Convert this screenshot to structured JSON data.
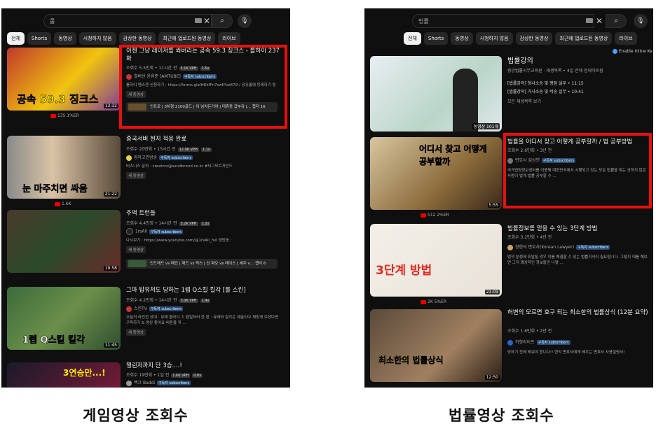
{
  "left": {
    "search_text": "롤",
    "chips": [
      "전체",
      "Shorts",
      "동영상",
      "시청하지 않음",
      "감상한 동영상",
      "최근에 업로드된 동영상",
      "라이브"
    ],
    "videos": [
      {
        "title": "이젠 그냥 레이저를 쏴버리는 공속 59.3 징크스 - 롤하이 237화",
        "meta": "조회수 5.5만회 • 11시간 전",
        "badges": [
          "5.1K VPH",
          "1.5x"
        ],
        "channel": "열버선 윤휴준 [AMTUBE]",
        "sub": "구독자 subscribers",
        "desc": "롤하이 멤스젠 신청하기 : https://forms.gle/ftEkfFn7sz4Pve679 / 공유롭에 등록하기 링크...",
        "newtag": "새 동영상",
        "chapter": "인트로 | 3차형 2100골드 | 이 넘치든거야 | 대휴동 갑부유 |… 챕터 16",
        "duration": "13:32",
        "stat": "135 1%ER",
        "thumb_text": "공속 59.3 징크스"
      },
      {
        "title": "중국서버 현지 적응 완료",
        "meta": "조회수 20만회 • 15시간 전",
        "badges": [
          "12.9K VPH",
          "1.1x"
        ],
        "channel": "동아고민방송",
        "sub": "구독자 subscribers",
        "desc": "비즈니스 문의 : creators@sandbrand.co.kr #티그모트개인드",
        "newtag": "새 동영상",
        "chapter": "",
        "duration": "21:22",
        "stat": "1.6K",
        "thumb_text": "눈 마주치면 싸움"
      },
      {
        "title": "주먹 트런들",
        "meta": "조회수 4.4만회 • 14시간 전",
        "badges": [
          "3.2K VPH",
          "1.2x"
        ],
        "channel": "1rsAll",
        "sub": "구독자 subscribers",
        "desc": "다시보기 : https://www.youtube.com/@1rsAll_full 생방송 : https://chzzk.naver.com/c74...",
        "newtag": "새 동영상",
        "chapter": "인드레드 vs 페인 | 제드 vs 럭스 | 신 짜오 vs 레이스 | 세주 v… 챕터 6",
        "duration": "19:58",
        "stat": "",
        "thumb_text": ""
      },
      {
        "title": "그마 탑유저도 당하는 1렙 Q스킬 킬각 [롤 스킨]",
        "meta": "조회수 4.2만회 • 14시간 전",
        "badges": [
          "3.0K VPH",
          "1.4x"
        ],
        "channel": "스킨TV",
        "sub": "구독자 subscribers",
        "desc": "오늘의 라인전 상대 : 뮤레 블라디 ㅎ 팬킬처러 한 판 : 뮤레와 칼각은 예술이다 재밌게 보셨다면 구독하기 & 영상 좋아요 버튼을 꼭 ...",
        "newtag": "새 동영상",
        "chapter": "",
        "duration": "11:45",
        "stat": "",
        "thumb_text": "1렙 Q스킬 킬각"
      },
      {
        "title": "챌린저까지 단 3승....!",
        "meta": "조회수 19만회 • 1일 전",
        "badges": [
          "1.6K VPH",
          "0.8x"
        ],
        "channel": "백크 Baddi",
        "sub": "구독자 subscribers",
        "desc": "",
        "newtag": "",
        "chapter": "",
        "duration": "",
        "stat": "",
        "thumb_text": "3연승만...!"
      }
    ],
    "caption": "게임영상 조회수"
  },
  "right": {
    "search_text": "법률",
    "chips": [
      "전체",
      "Shorts",
      "동영상",
      "시청하지 않음",
      "감상한 동영상",
      "최근에 업로드된 동영상",
      "라이브"
    ],
    "inline_toggle": "Enable Inline Ke",
    "videos": [
      {
        "title": "법률강의",
        "meta": "중앙법률사무교육원 · 재생목록 • 4일 전에 업데이트됨",
        "lines": [
          "[법률강의] 형사소송 및 쟁점 실무 • 11:15",
          "[법률강의] 가사소송 및 비송 실무 • 10:41",
          "모든 재생목록 보기"
        ],
        "duration": "동영상 101개",
        "thumb_text": ""
      },
      {
        "title": "법률을 어디서 찾고 어떻게 공부할까 / 법 공부방법",
        "meta": "조회수 2.6만회 • 3년 전",
        "channel": "변호사 김상연",
        "sub": "구독자 subscribers",
        "desc": "국가법령정보센터를 이용해 대한민국에서 시행되고 있는 모든 법률을 찾는 공하지 않은 사람이 법계 법률 공부할 수 ...",
        "duration": "5:55",
        "stat": "512 2%ER",
        "thumb_text": "어디서 찾고 어떻게 공부할까"
      },
      {
        "title": "법률정보를 얻을 수 있는 3단계 방법",
        "meta": "조회수 3.2만회 • 4년 전",
        "channel": "정현석 변호사(Korean Lawyer)",
        "sub": "구독자 subscribers",
        "desc": "법적 분쟁에 휘말릴 경우 이를 해결할 수 있는 법률지식이 필요합니다. 그렇지 데를 해보면 그저 꽤상적인 정보들만 나열 ...",
        "duration": "23:09",
        "stat": "2K 5%ER",
        "thumb_text": "3단계 방법"
      },
      {
        "title": "허변의 모르면 호구 되는 최소한의 법률상식 (12분 요약)",
        "meta": "조회수 1.6만회 • 2년 전",
        "channel": "허형라이프",
        "sub": "구독자 subscribers",
        "desc": "망하기 전에 배워야 합니다!! 현직 변호사에게 배우는 변호사 사용설명서!",
        "duration": "12:50",
        "stat": "",
        "thumb_text": "최소한의 법률상식"
      }
    ],
    "caption": "법률영상 조회수"
  }
}
